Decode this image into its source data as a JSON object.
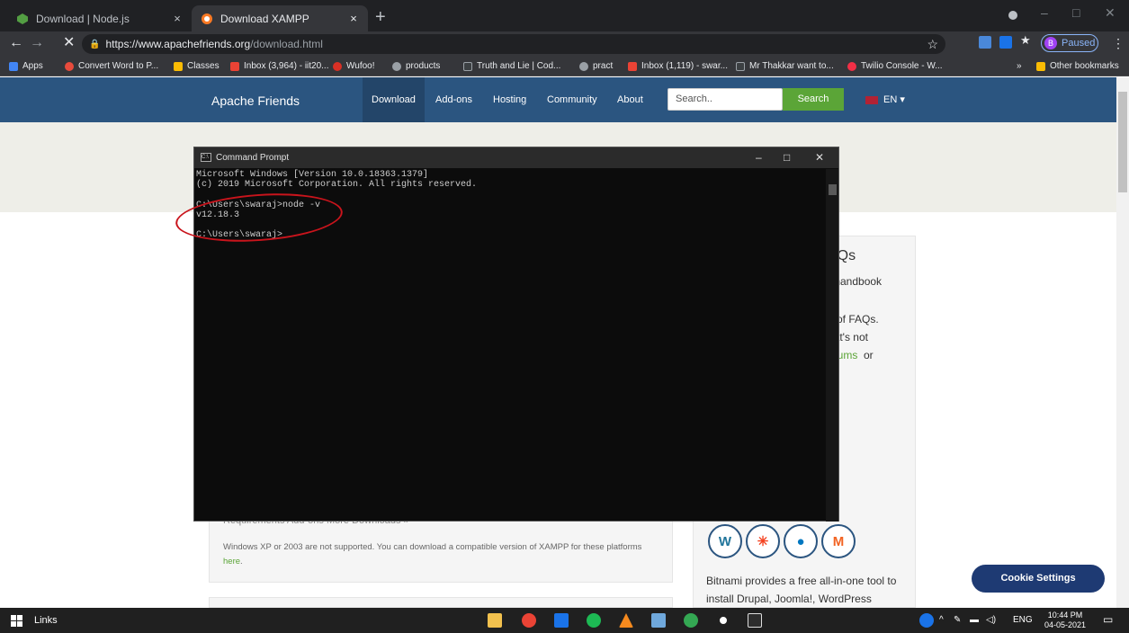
{
  "browser": {
    "tabs": [
      {
        "title": "Download | Node.js",
        "close": "×"
      },
      {
        "title": "Download XAMPP",
        "close": "×"
      }
    ],
    "new_tab": "+",
    "window_controls": [
      "–",
      "□",
      "✕"
    ],
    "url_host": "https://www.apachefriends.org",
    "url_path": "/download.html",
    "profile_initial": "B",
    "profile_status": "Paused",
    "nav": {
      "back": "←",
      "forward": "→",
      "stop": "✕"
    },
    "bookmarks": [
      {
        "label": "Apps",
        "color": "#4285f4"
      },
      {
        "label": "Convert Word to P...",
        "color": "#e84b3c"
      },
      {
        "label": "Classes",
        "color": "#fbbc04"
      },
      {
        "label": "Inbox (3,964) - iit20...",
        "color": "#ea4335"
      },
      {
        "label": "Wufoo!",
        "color": "#d93025"
      },
      {
        "label": "products",
        "color": "#9aa0a6"
      },
      {
        "label": "Truth and Lie | Cod...",
        "color": "#3c4043"
      },
      {
        "label": "pract",
        "color": "#9aa0a6"
      },
      {
        "label": "Inbox (1,119) - swar...",
        "color": "#ea4335"
      },
      {
        "label": "Mr Thakkar want to...",
        "color": "#3c4043"
      },
      {
        "label": "Twilio Console - W...",
        "color": "#f22f46"
      }
    ],
    "overflow": "»",
    "other_bookmarks": "Other bookmarks"
  },
  "site": {
    "brand": "Apache Friends",
    "nav": [
      "Download",
      "Add-ons",
      "Hosting",
      "Community",
      "About"
    ],
    "search_placeholder": "Search..",
    "search_button": "Search",
    "lang": "EN",
    "faq_fragments": [
      "AQs",
      "r handbook",
      "n of FAQs.",
      "hat's not",
      "orums",
      "or",
      "s"
    ],
    "requirements_links": "Requirements   Add-ons   More Downloads »",
    "note_text": "Windows XP or 2003 are not supported. You can download a compatible version of XAMPP for these platforms",
    "note_link": "here",
    "cms_icons": [
      "wordpress-icon",
      "joomla-icon",
      "drupal-icon",
      "magento-icon"
    ],
    "bitnami_text": "Bitnami provides a free all-in-one tool to install Drupal, Joomla!, WordPress",
    "cookie_button": "Cookie Settings"
  },
  "cmd": {
    "title": "Command Prompt",
    "controls": [
      "–",
      "□",
      "✕"
    ],
    "lines": [
      "Microsoft Windows [Version 10.0.18363.1379]",
      "(c) 2019 Microsoft Corporation. All rights reserved.",
      "",
      "C:\\Users\\swaraj>node -v",
      "v12.18.3",
      "",
      "C:\\Users\\swaraj>"
    ]
  },
  "taskbar": {
    "search_label": "Links",
    "tray_lang": "ENG",
    "time": "10:44 PM",
    "date": "04-05-2021"
  }
}
